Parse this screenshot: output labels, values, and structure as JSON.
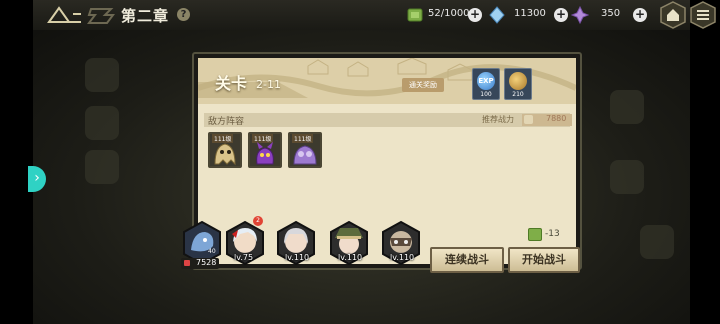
{
  "topbar": {
    "chapter_title": "第二章",
    "help_glyph": "?",
    "resources": [
      {
        "name": "stamina",
        "icon": "stamina-cube-icon",
        "value": "52/1000",
        "color": "#7fae48"
      },
      {
        "name": "crystal",
        "icon": "crystal-icon",
        "value": "11300",
        "color": "#9fd0f0"
      },
      {
        "name": "gem",
        "icon": "purple-gem-icon",
        "value": "350",
        "color": "#b28ad8"
      }
    ],
    "plus_glyph": "+"
  },
  "side_tab": {
    "glyph": "›",
    "color": "#2fd2c4"
  },
  "stage": {
    "title": "关卡",
    "number": "2-11",
    "reward_label": "通关奖励",
    "rewards": [
      {
        "icon": "exp-icon",
        "label": "EXP",
        "amount": "100"
      },
      {
        "icon": "coin-icon",
        "amount": "210"
      }
    ],
    "enemy_section_label": "敌方阵容",
    "recommended_power_label": "推荐战力",
    "recommended_power_value": "7880",
    "enemies": [
      {
        "level": "111级",
        "icon": "tan-ghost-enemy-icon"
      },
      {
        "level": "111级",
        "icon": "purple-imp-enemy-icon"
      },
      {
        "level": "111级",
        "icon": "purple-slime-enemy-icon"
      }
    ],
    "stamina_cost": "-13",
    "buttons": {
      "auto_battle": "连续战斗",
      "start_battle": "开始战斗"
    }
  },
  "team": {
    "leader_level_fragment": "40",
    "leader_power": "7528",
    "heroes": [
      {
        "icon": "white-haired-hero-portrait",
        "level": "lv.75",
        "badge": "2"
      },
      {
        "icon": "silver-haired-hero-portrait",
        "level": "lv.110"
      },
      {
        "icon": "green-hat-hero-portrait",
        "level": "lv.110"
      },
      {
        "icon": "masked-hero-portrait",
        "level": "lv.110"
      }
    ]
  }
}
